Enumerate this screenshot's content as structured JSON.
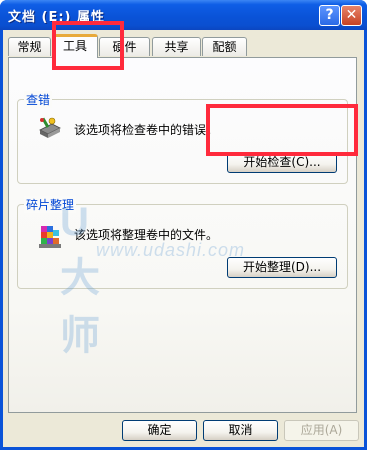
{
  "window": {
    "title": "文档 (E:) 属性",
    "help_glyph": "?",
    "close_glyph": "✕"
  },
  "tabs": [
    {
      "label": "常规",
      "active": false
    },
    {
      "label": "工具",
      "active": true
    },
    {
      "label": "硬件",
      "active": false
    },
    {
      "label": "共享",
      "active": false
    },
    {
      "label": "配额",
      "active": false
    }
  ],
  "error_check": {
    "title": "查错",
    "description": "该选项将检查卷中的错误。",
    "button_label": "开始检查(C)..."
  },
  "defrag": {
    "title": "碎片整理",
    "description": "该选项将整理卷中的文件。",
    "button_label": "开始整理(D)..."
  },
  "footer": {
    "ok_label": "确定",
    "cancel_label": "取消",
    "apply_label": "应用(A)"
  },
  "watermark": {
    "logo": "U大师",
    "url": "www.udashi.com"
  },
  "colors": {
    "highlight_box": "#ff2a3c",
    "group_title": "#0046d5",
    "titlebar": "#0a53d8"
  }
}
